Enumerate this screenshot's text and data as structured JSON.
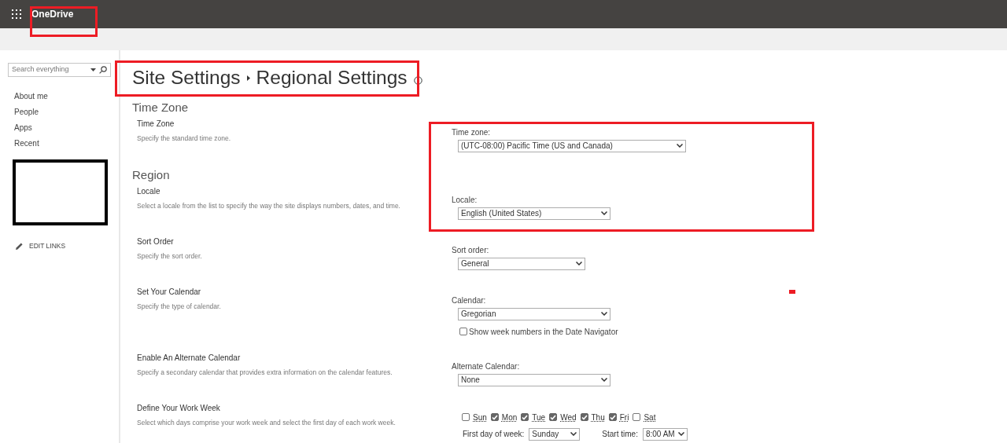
{
  "app": {
    "name": "OneDrive"
  },
  "sidebar": {
    "search": {
      "placeholder": "Search everything"
    },
    "items": [
      {
        "label": "About me"
      },
      {
        "label": "People"
      },
      {
        "label": "Apps"
      },
      {
        "label": "Recent"
      }
    ],
    "edit_links": "EDIT LINKS"
  },
  "breadcrumb": [
    "Site Settings",
    "Regional Settings"
  ],
  "sections": [
    {
      "title": "Time Zone",
      "settings": [
        {
          "title": "Time Zone",
          "description": "Specify the standard time zone.",
          "fields": [
            {
              "kind": "dropdown",
              "label": "Time zone:",
              "value": "(UTC-08:00) Pacific Time (US and Canada)"
            }
          ]
        }
      ]
    },
    {
      "title": "Region",
      "settings": [
        {
          "title": "Locale",
          "description": "Select a locale from the list to specify the way the site displays numbers, dates, and time.",
          "fields": [
            {
              "kind": "dropdown",
              "label": "Locale:",
              "value": "English (United States)"
            }
          ]
        },
        {
          "title": "Sort Order",
          "description": "Specify the sort order.",
          "fields": [
            {
              "kind": "dropdown",
              "label": "Sort order:",
              "value": "General"
            }
          ]
        },
        {
          "title": "Set Your Calendar",
          "description": "Specify the type of calendar.",
          "fields": [
            {
              "kind": "dropdown",
              "label": "Calendar:",
              "value": "Gregorian"
            },
            {
              "kind": "checkbox",
              "label": "Show week numbers in the Date Navigator",
              "checked": false
            }
          ]
        },
        {
          "title": "Enable An Alternate Calendar",
          "description": "Specify a secondary calendar that provides extra information on the calendar features.",
          "fields": [
            {
              "kind": "dropdown",
              "label": "Alternate Calendar:",
              "value": "None"
            }
          ]
        },
        {
          "title": "Define Your Work Week",
          "description": "Select which days comprise your work week and select the first day of each work week.",
          "fields": [
            {
              "kind": "days",
              "days": [
                {
                  "label": "Sun",
                  "checked": false
                },
                {
                  "label": "Mon",
                  "checked": true
                },
                {
                  "label": "Tue",
                  "checked": true
                },
                {
                  "label": "Wed",
                  "checked": true
                },
                {
                  "label": "Thu",
                  "checked": true
                },
                {
                  "label": "Fri",
                  "checked": true
                },
                {
                  "label": "Sat",
                  "checked": false
                }
              ]
            },
            {
              "kind": "pairs",
              "items": [
                {
                  "label": "First day of week:",
                  "value": "Sunday"
                },
                {
                  "label": "Start time:",
                  "value": "8:00 AM"
                }
              ]
            }
          ]
        }
      ]
    }
  ]
}
